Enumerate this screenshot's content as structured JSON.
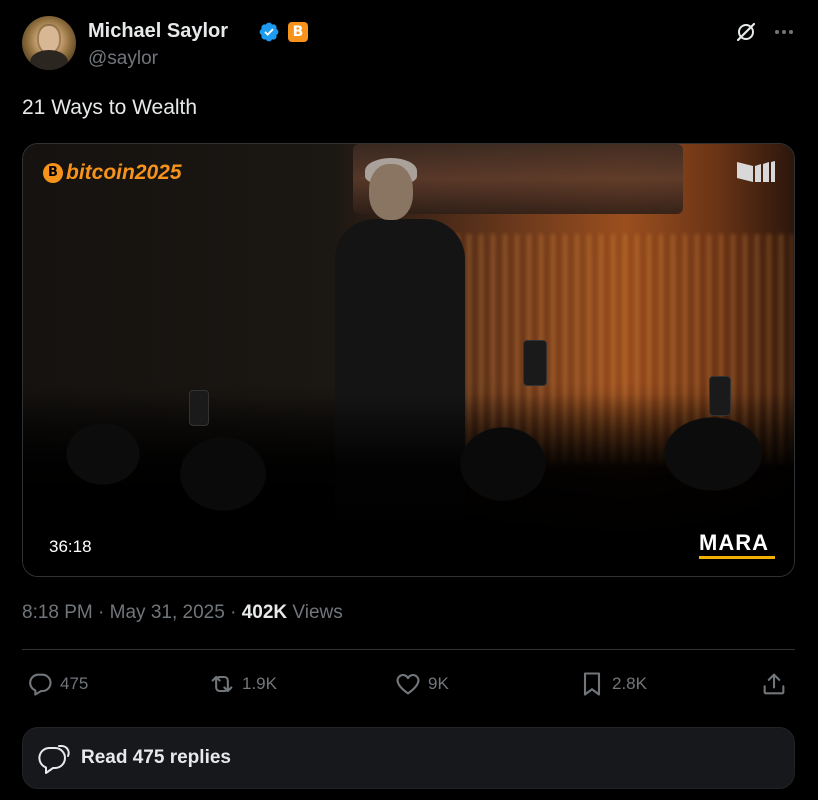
{
  "author": {
    "name": "Michael Saylor",
    "handle": "@saylor",
    "verified": true,
    "badge_label": "B"
  },
  "tweet": {
    "text": "21 Ways to Wealth"
  },
  "media": {
    "logo_text": "bitcoin2025",
    "logo_coin": "B",
    "duration": "36:18",
    "sponsor": "MARA"
  },
  "meta": {
    "time": "8:18 PM",
    "separator": "·",
    "date": "May 31, 2025",
    "views_count": "402K",
    "views_label": "Views"
  },
  "actions": {
    "replies": "475",
    "reposts": "1.9K",
    "likes": "9K",
    "bookmarks": "2.8K"
  },
  "read_replies": {
    "label": "Read 475 replies"
  },
  "colors": {
    "background": "#000000",
    "text": "#e7e9ea",
    "muted": "#71767b",
    "verified_blue": "#1d9bf0",
    "bitcoin_orange": "#f7931a",
    "mara_yellow": "#f0b000"
  },
  "icons": {
    "avatar": "profile-photo",
    "verified": "verified-check-icon",
    "grok": "grok-icon",
    "more": "more-horizontal-icon",
    "reply": "reply-bubble-icon",
    "repost": "repost-icon",
    "like": "heart-icon",
    "bookmark": "bookmark-icon",
    "share": "share-icon",
    "read_replies": "chat-bubbles-icon"
  }
}
